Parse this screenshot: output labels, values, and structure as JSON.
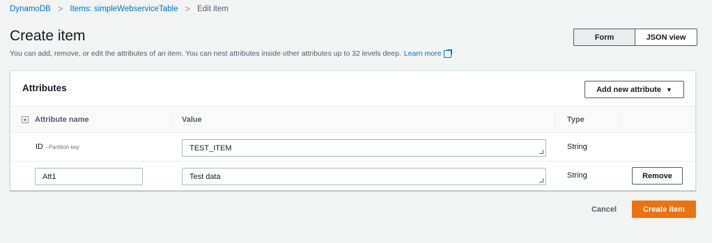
{
  "breadcrumb": {
    "items": [
      "DynamoDB",
      "Items: simpleWebserviceTable"
    ],
    "current": "Edit item",
    "separator": ">"
  },
  "header": {
    "title": "Create item",
    "description": "You can add, remove, or edit the attributes of an item. You can nest attributes inside other attributes up to 32 levels deep.",
    "learn_more": "Learn more",
    "view_toggle": {
      "form": "Form",
      "json": "JSON view",
      "selected": "Form"
    }
  },
  "attributes": {
    "title": "Attributes",
    "add_button": "Add new attribute",
    "columns": {
      "name": "Attribute name",
      "value": "Value",
      "type": "Type"
    },
    "rows": [
      {
        "name": "ID",
        "key_note": "- Partition key",
        "value": "TEST_ITEM",
        "type": "String"
      },
      {
        "name": "Att1",
        "value": "Test data",
        "type": "String",
        "remove_label": "Remove"
      }
    ]
  },
  "footer": {
    "cancel": "Cancel",
    "create": "Create item"
  },
  "colors": {
    "link": "#0073bb",
    "primary": "#ec7211",
    "background": "#f2f3f3"
  },
  "icons": {
    "external_link": "external-link-icon",
    "dropdown": "caret-down-icon",
    "expand": "expand-all-icon"
  }
}
